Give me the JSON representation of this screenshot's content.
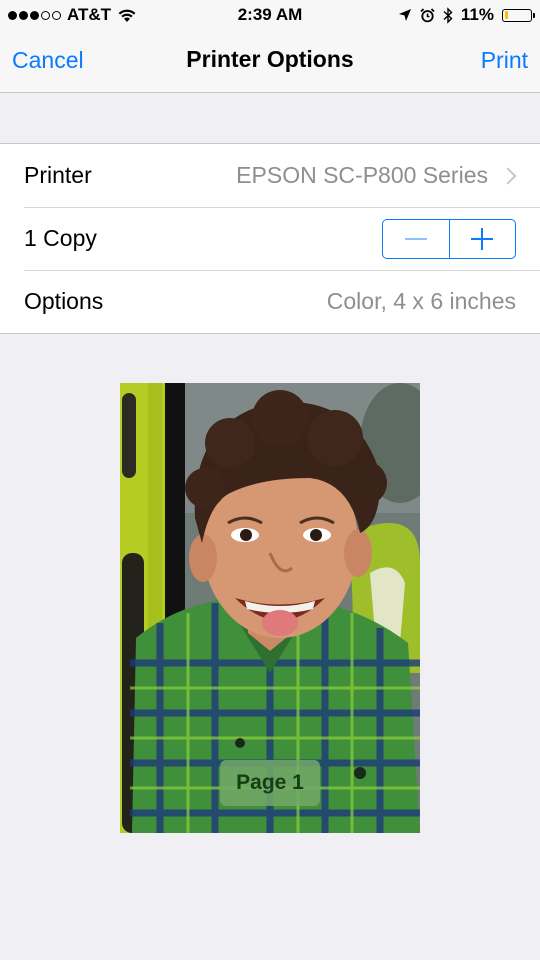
{
  "status_bar": {
    "carrier": "AT&T",
    "time": "2:39 AM",
    "battery_percent": "11%",
    "signal_bars_filled": 3,
    "signal_bars_total": 5,
    "battery_level": 0.11,
    "icons": [
      "wifi-icon",
      "location-icon",
      "alarm-icon",
      "bluetooth-icon",
      "battery-icon"
    ]
  },
  "nav": {
    "cancel_label": "Cancel",
    "title": "Printer Options",
    "print_label": "Print"
  },
  "settings": {
    "printer_label": "Printer",
    "printer_value": "EPSON SC-P800 Series",
    "copies_label": "1 Copy",
    "options_label": "Options",
    "options_value": "Color, 4 x 6 inches"
  },
  "preview": {
    "page_label": "Page 1",
    "image_subject": "smiling child in green plaid shirt next to green playground structure"
  },
  "colors": {
    "accent": "#0a7aff",
    "background": "#efeff4",
    "secondary_text": "#8e8e93",
    "battery_low": "#f5c400"
  }
}
